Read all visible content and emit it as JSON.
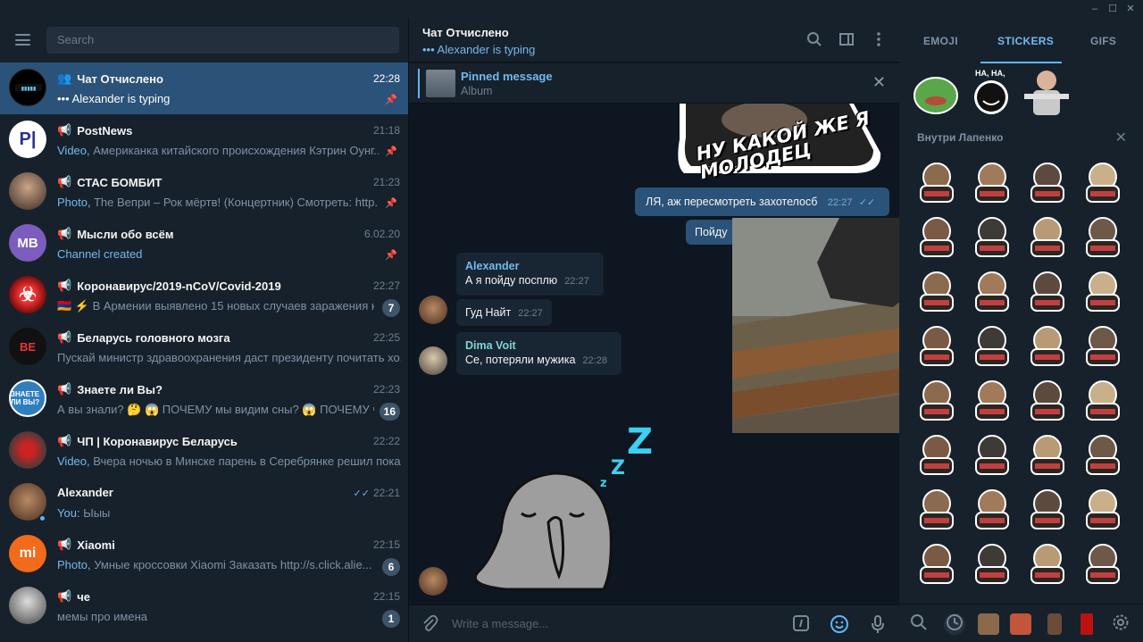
{
  "window": {
    "minimize": "–",
    "maximize": "☐",
    "close": "✕"
  },
  "sidebar": {
    "search_placeholder": "Search",
    "chats": [
      {
        "name": "Чат Отчислено",
        "type": "group",
        "time": "22:28",
        "preview": "Alexander is typing",
        "preview_prefix": "•••",
        "pinned": true,
        "active": true
      },
      {
        "name": "PostNews",
        "type": "channel",
        "time": "21:18",
        "prefix": "Video,",
        "preview": "Американка китайского происхождения Кэтрин Оунг...",
        "pinned": true
      },
      {
        "name": "СТАС БОМБИТ",
        "type": "channel",
        "time": "21:23",
        "prefix": "Photo,",
        "preview": "The Вепри – Рок мёртв! (Концертник)  Смотреть: http...",
        "pinned": true
      },
      {
        "name": "Мысли обо всём",
        "type": "channel",
        "time": "6.02.20",
        "prefix": "Channel created",
        "preview": "",
        "pinned": true,
        "avatar_text": "MB"
      },
      {
        "name": "Коронавирус/2019-nCoV/Covid-2019",
        "type": "channel",
        "time": "22:27",
        "preview": "🇦🇲 ⚡ В Армении выявлено 15 новых случаев заражения ко...",
        "badge": "7"
      },
      {
        "name": "Беларусь головного мозга",
        "type": "channel",
        "time": "22:25",
        "preview": "Пускай министр здравоохранения даст президенту почитать хо..."
      },
      {
        "name": "Знаете ли Вы?",
        "type": "channel",
        "time": "22:23",
        "preview": "А вы знали? 🤔  😱 ПОЧЕМУ мы видим сны? 😱 ПОЧЕМУ чи...",
        "badge": "16"
      },
      {
        "name": "ЧП | Коронавирус Беларусь",
        "type": "channel",
        "time": "22:22",
        "prefix": "Video,",
        "preview": "Вчера ночью в Минске парень в Серебрянке решил пока..."
      },
      {
        "name": "Alexander",
        "type": "user",
        "time": "22:21",
        "prefix": "You:",
        "preview": "Ыыы",
        "read": true
      },
      {
        "name": "Xiaomi",
        "type": "channel",
        "time": "22:15",
        "prefix": "Photo,",
        "preview": "Умные кроссовки Xiaomi  Заказать     http://s.click.alie...",
        "badge": "6"
      },
      {
        "name": "че",
        "type": "channel",
        "time": "22:15",
        "preview": "мемы про имена",
        "badge": "1"
      }
    ]
  },
  "chat": {
    "title": "Чат Отчислено",
    "status": "••• Alexander is typing",
    "pinned_title": "Pinned message",
    "pinned_sub": "Album",
    "messages": [
      {
        "kind": "out",
        "text": "ЛЯ,  аж пересмотреть захотелосб",
        "time": "22:27"
      },
      {
        "kind": "out",
        "text": "Пойду"
      },
      {
        "kind": "in",
        "sender": "Alexander",
        "text": "А я пойду посплю",
        "time": "22:27"
      },
      {
        "kind": "in",
        "text": "Гуд Найт",
        "time": "22:27"
      },
      {
        "kind": "in",
        "sender": "Dima Voit",
        "text": "Се, потеряли мужика",
        "time": "22:28"
      }
    ],
    "sticker_caption": "НУ КАКОЙ ЖЕ Я МОЛОДЕЦ",
    "sleep_letters": [
      "Z",
      "Z",
      "z"
    ],
    "compose_placeholder": "Write a message..."
  },
  "panel": {
    "tabs": [
      "EMOJI",
      "STICKERS",
      "GIFS"
    ],
    "active_tab": "STICKERS",
    "recent_caption": "НА, НА,",
    "section_title": "Внутри Лапенко"
  },
  "colors": {
    "accent": "#5eb5f7",
    "active": "#2b5278",
    "bg": "#0e1621",
    "panel": "#17212b"
  }
}
